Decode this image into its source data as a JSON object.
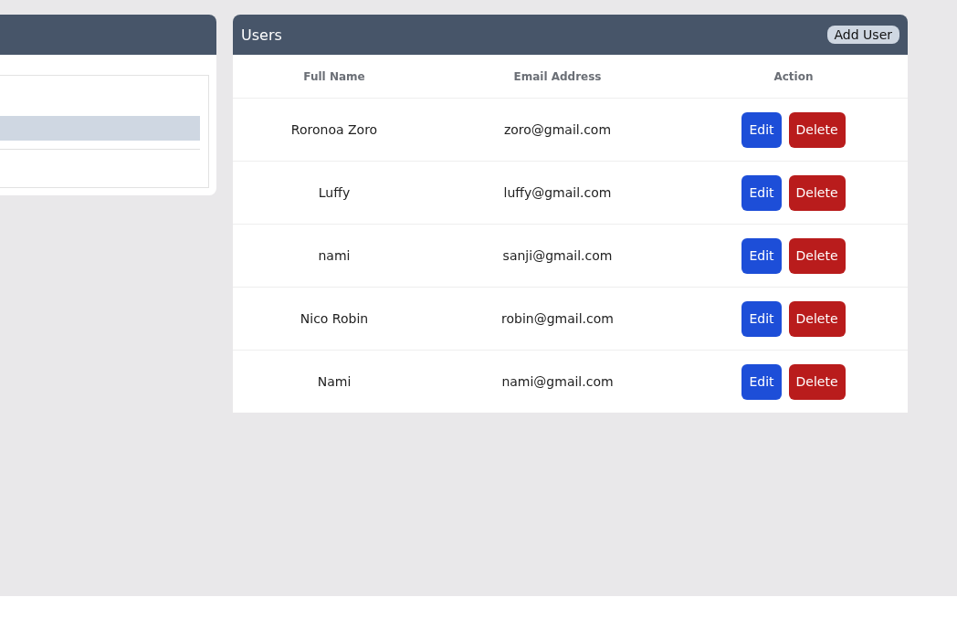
{
  "users_panel": {
    "title": "Users",
    "add_button": "Add User"
  },
  "table": {
    "columns": [
      "Full Name",
      "Email Address",
      "Action"
    ],
    "rows": [
      {
        "name": "Roronoa Zoro",
        "email": "zoro@gmail.com",
        "edit": "Edit",
        "delete": "Delete"
      },
      {
        "name": "Luffy",
        "email": "luffy@gmail.com",
        "edit": "Edit",
        "delete": "Delete"
      },
      {
        "name": "nami",
        "email": "sanji@gmail.com",
        "edit": "Edit",
        "delete": "Delete"
      },
      {
        "name": "Nico Robin",
        "email": "robin@gmail.com",
        "edit": "Edit",
        "delete": "Delete"
      },
      {
        "name": "Nami",
        "email": "nami@gmail.com",
        "edit": "Edit",
        "delete": "Delete"
      }
    ]
  }
}
